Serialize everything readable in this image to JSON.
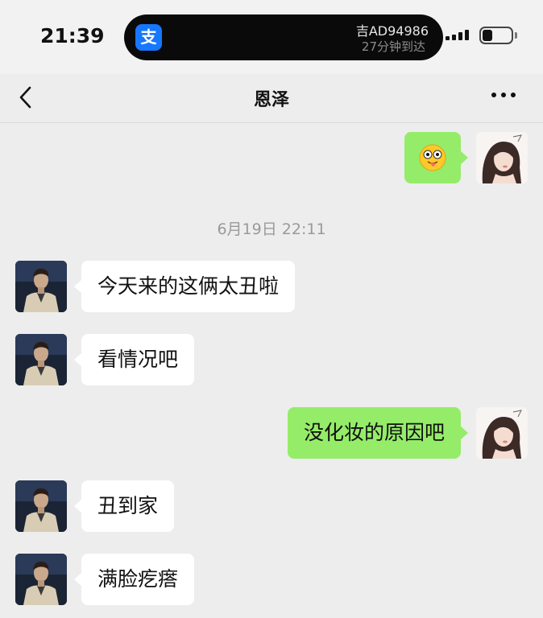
{
  "status_bar": {
    "time": "21:39",
    "alipay_icon_glyph": "支",
    "live_activity_plate": "吉AD94986",
    "live_activity_eta": "27分钟到达",
    "icons": [
      "alipay-icon",
      "signal-icon",
      "battery-icon"
    ]
  },
  "nav": {
    "title": "恩泽",
    "back_icon": "chevron-left-icon",
    "more_icon": "more-icon"
  },
  "timestamp": "6月19日 22:11",
  "messages": [
    {
      "direction": "out",
      "type": "emoji",
      "emoji": "smiling-face-with-tongue-emoji"
    },
    {
      "direction": "in",
      "type": "text",
      "text": "今天来的这俩太丑啦"
    },
    {
      "direction": "in",
      "type": "text",
      "text": "看情况吧"
    },
    {
      "direction": "out",
      "type": "text",
      "text": "没化妆的原因吧"
    },
    {
      "direction": "in",
      "type": "text",
      "text": "丑到家"
    },
    {
      "direction": "in",
      "type": "text",
      "text": "满脸疙瘩"
    }
  ],
  "colors": {
    "background": "#ededed",
    "incoming_bubble": "#ffffff",
    "outgoing_bubble": "#95ec69",
    "timestamp": "#9a9a9a"
  }
}
